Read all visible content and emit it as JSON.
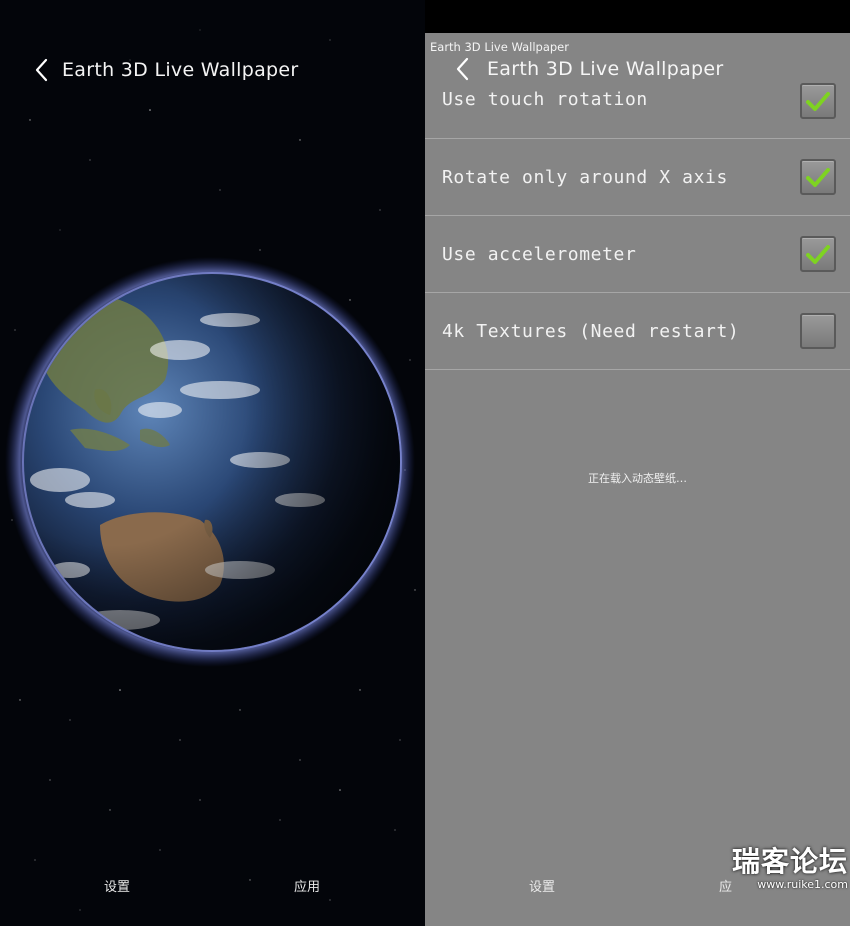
{
  "left": {
    "title": "Earth 3D Live Wallpaper",
    "bottom_bar": {
      "settings_label": "设置",
      "apply_label": "应用"
    }
  },
  "right": {
    "tiny_title": "Earth 3D Live Wallpaper",
    "title": "Earth 3D Live Wallpaper",
    "preferences": [
      {
        "label": "Use touch rotation",
        "checked": true
      },
      {
        "label": "Rotate only around X axis",
        "checked": true
      },
      {
        "label": "Use accelerometer",
        "checked": true
      },
      {
        "label": "4k Textures (Need restart)",
        "checked": false
      }
    ],
    "loading_text": "正在载入动态壁纸…",
    "bottom_bar": {
      "settings_label": "设置",
      "apply_label": "应"
    },
    "watermark": {
      "text": "瑞客论坛",
      "url": "www.ruike1.com"
    }
  },
  "colors": {
    "panel_gray": "#858585",
    "check_green": "#7ed321",
    "space_black": "#03050a"
  }
}
